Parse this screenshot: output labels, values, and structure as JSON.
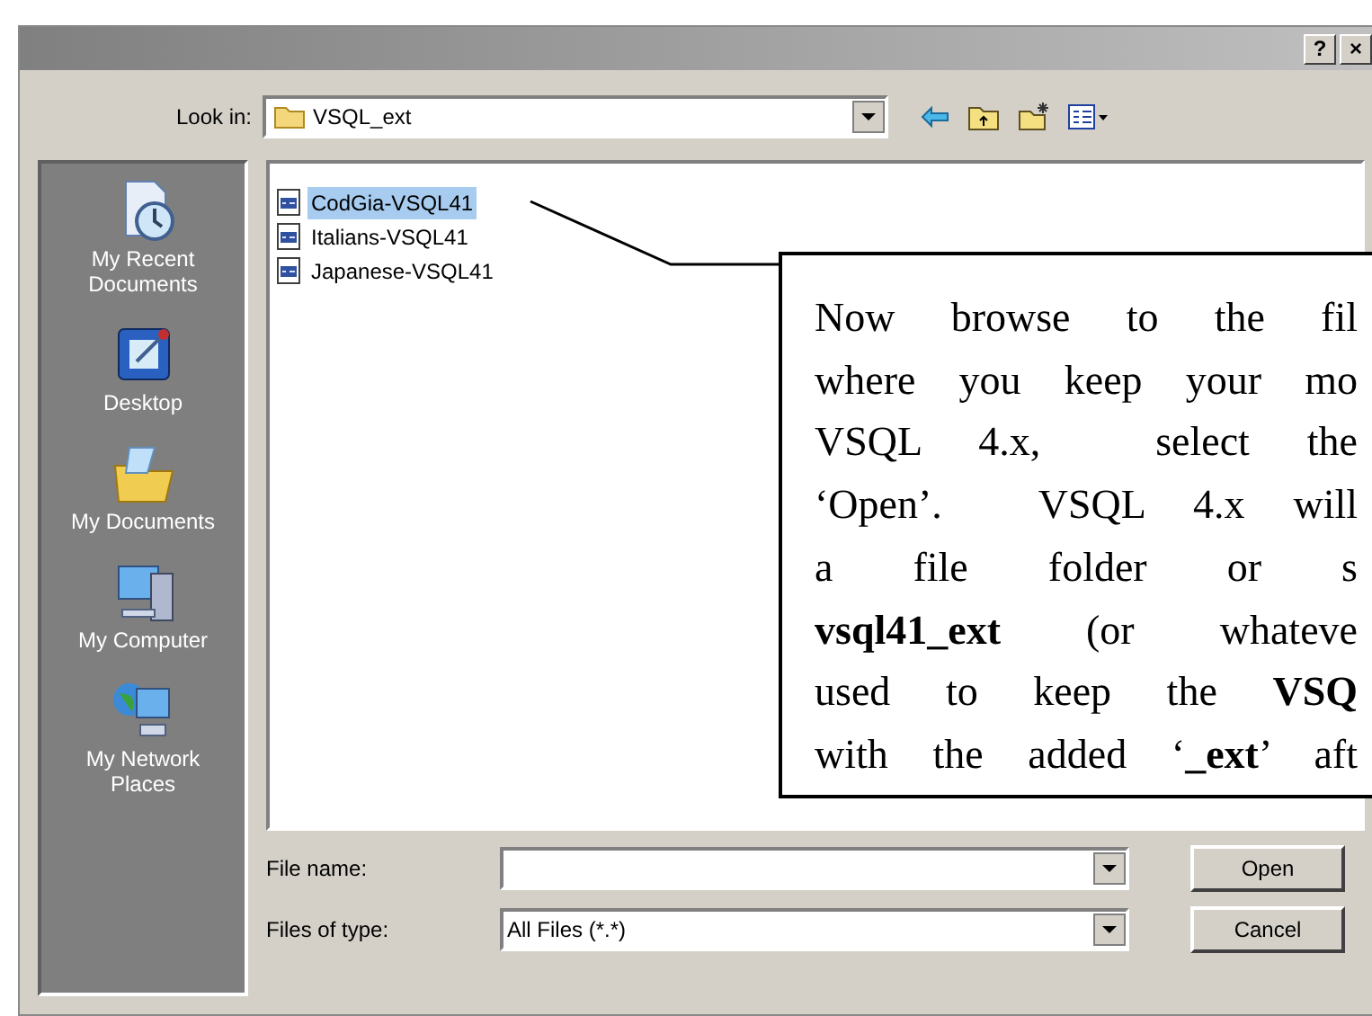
{
  "window": {
    "buttons": [
      "?",
      "×"
    ]
  },
  "look_in": {
    "label": "Look in:",
    "value": "VSQL_ext"
  },
  "places": [
    {
      "label": "My Recent Documents",
      "kind": "recent"
    },
    {
      "label": "Desktop",
      "kind": "desktop"
    },
    {
      "label": "My Documents",
      "kind": "documents"
    },
    {
      "label": "My Computer",
      "kind": "computer"
    },
    {
      "label": "My Network Places",
      "kind": "network"
    }
  ],
  "files": [
    {
      "name": "CodGia-VSQL41",
      "selected": true
    },
    {
      "name": "Italians-VSQL41",
      "selected": false
    },
    {
      "name": "Japanese-VSQL41",
      "selected": false
    }
  ],
  "file_name": {
    "label": "File name:"
  },
  "file_type": {
    "label": "Files of type:",
    "value": "All Files (*.*)"
  },
  "buttons": [
    "Open",
    "Cancel"
  ],
  "callout": {
    "lines": [
      "Now browse to the fil",
      "where you keep your mo",
      "VSQL 4.x,  select the",
      "‘Open’.  VSQL 4.x will",
      "a file folder or s",
      "**vsql41_ext** (or whateve",
      "used to keep the **VSQ**",
      "with the added ‘**_ext**’ aft"
    ]
  }
}
